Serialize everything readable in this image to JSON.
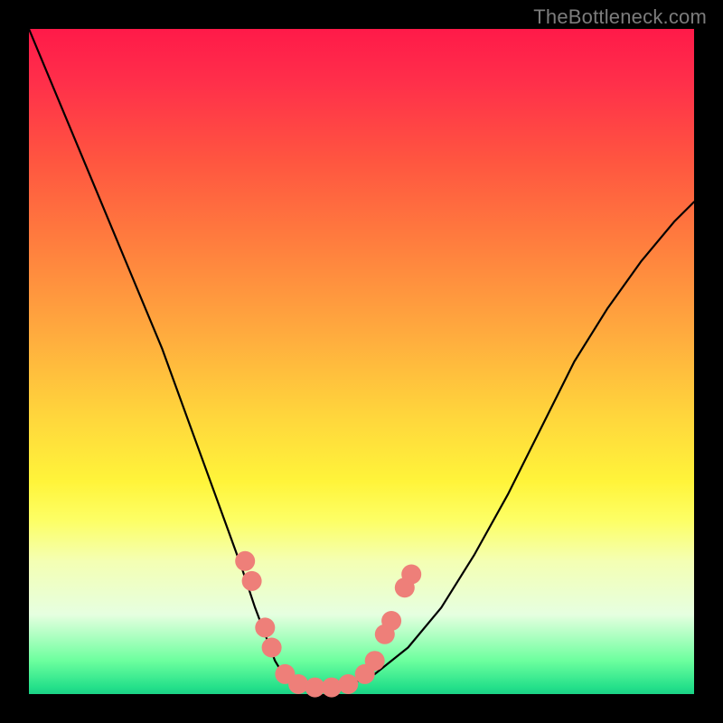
{
  "watermark": "TheBottleneck.com",
  "chart_data": {
    "type": "line",
    "title": "",
    "xlabel": "",
    "ylabel": "",
    "xlim": [
      0,
      100
    ],
    "ylim": [
      0,
      100
    ],
    "series": [
      {
        "name": "bottleneck-curve",
        "x": [
          0,
          5,
          10,
          15,
          20,
          24,
          28,
          32,
          34,
          35.5,
          37,
          38.5,
          40,
          42,
          47,
          52,
          57,
          62,
          67,
          72,
          77,
          82,
          87,
          92,
          97,
          100
        ],
        "y": [
          100,
          88,
          76,
          64,
          52,
          41,
          30,
          19,
          13,
          9,
          5,
          2.5,
          1,
          1,
          1,
          3,
          7,
          13,
          21,
          30,
          40,
          50,
          58,
          65,
          71,
          74
        ]
      }
    ],
    "markers": [
      {
        "name": "point-left-upper",
        "x": 32.5,
        "y": 20
      },
      {
        "name": "point-left-mid",
        "x": 33.5,
        "y": 17
      },
      {
        "name": "point-left-low-1",
        "x": 35.5,
        "y": 10
      },
      {
        "name": "point-left-low-2",
        "x": 36.5,
        "y": 7
      },
      {
        "name": "point-valley-1",
        "x": 38.5,
        "y": 3
      },
      {
        "name": "point-valley-2",
        "x": 40.5,
        "y": 1.5
      },
      {
        "name": "point-valley-3",
        "x": 43,
        "y": 1
      },
      {
        "name": "point-valley-4",
        "x": 45.5,
        "y": 1
      },
      {
        "name": "point-valley-5",
        "x": 48,
        "y": 1.5
      },
      {
        "name": "point-right-low-1",
        "x": 50.5,
        "y": 3
      },
      {
        "name": "point-right-low-2",
        "x": 52,
        "y": 5
      },
      {
        "name": "point-right-mid-1",
        "x": 53.5,
        "y": 9
      },
      {
        "name": "point-right-mid-2",
        "x": 54.5,
        "y": 11
      },
      {
        "name": "point-right-upper-1",
        "x": 56.5,
        "y": 16
      },
      {
        "name": "point-right-upper-2",
        "x": 57.5,
        "y": 18
      }
    ],
    "marker_color": "#ee7f79",
    "marker_radius": 11,
    "line_color": "#000000",
    "line_width": 2.2
  }
}
